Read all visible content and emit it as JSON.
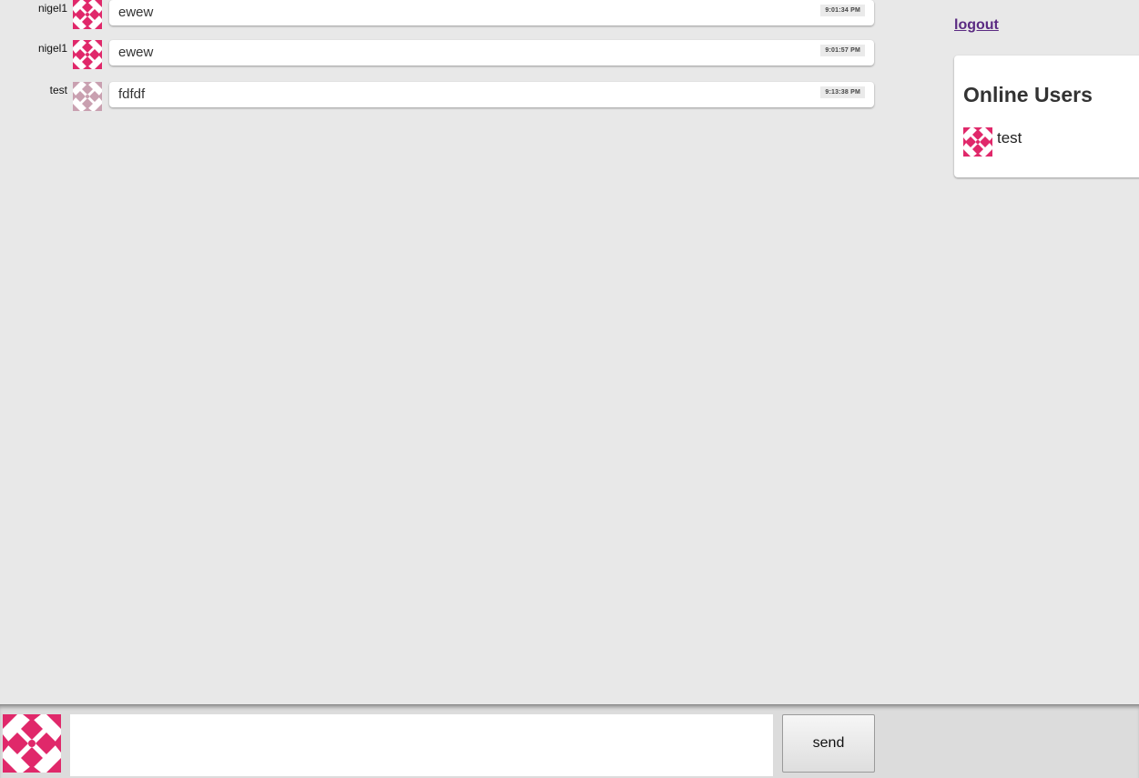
{
  "messages": [
    {
      "user": "nigel1",
      "text": "ewew",
      "time": "9:01:34 PM",
      "avatar": "quilt-avatar-icon",
      "avatar_color": "#e0286a"
    },
    {
      "user": "nigel1",
      "text": "ewew",
      "time": "9:01:57 PM",
      "avatar": "quilt-avatar-icon",
      "avatar_color": "#e0286a"
    },
    {
      "user": "test",
      "text": "fdfdf",
      "time": "9:13:38 PM",
      "avatar": "quilt-avatar-icon",
      "avatar_color": "#c9a0b0"
    }
  ],
  "sidebar": {
    "logout_label": "logout",
    "online_title": "Online Users",
    "online_users": [
      {
        "name": "test",
        "avatar": "quilt-avatar-icon",
        "avatar_color": "#e0286a"
      }
    ]
  },
  "composer": {
    "message_value": "",
    "send_label": "send",
    "avatar": "quilt-avatar-icon",
    "avatar_color": "#e0286a"
  },
  "colors": {
    "background": "#e8e8e8",
    "link": "#5a2a82",
    "avatar_primary": "#e0286a",
    "avatar_faded": "#c9a0b0"
  }
}
